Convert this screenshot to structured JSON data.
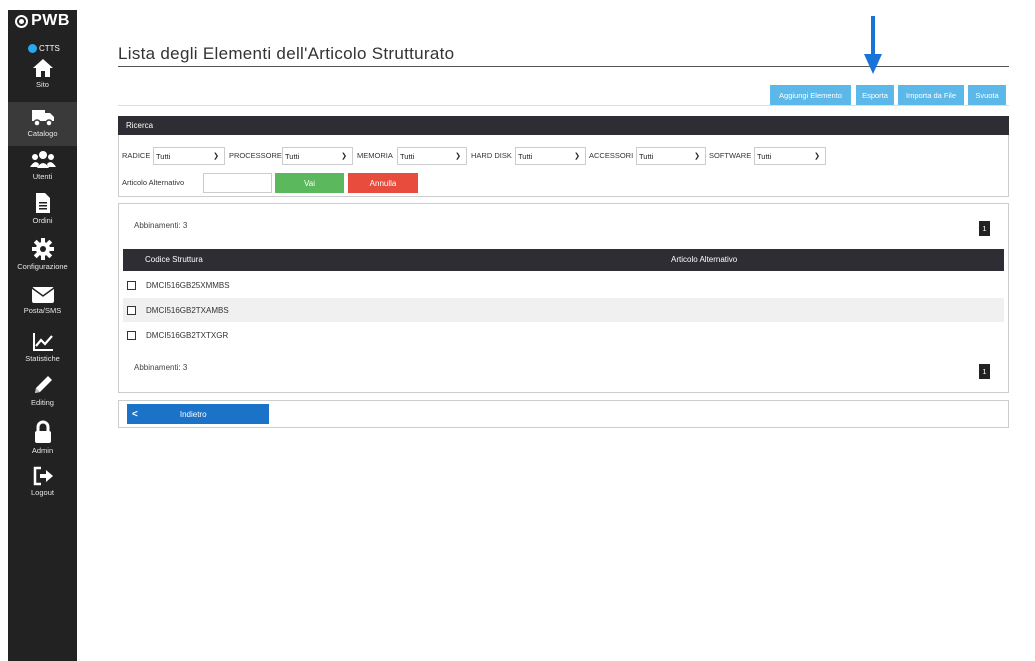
{
  "brand": {
    "name": "PWB",
    "status": "CTTS"
  },
  "sidebar": {
    "items": [
      {
        "label": "Sito",
        "icon": "home-icon"
      },
      {
        "label": "Catalogo",
        "icon": "truck-icon",
        "active": true
      },
      {
        "label": "Utenti",
        "icon": "users-icon"
      },
      {
        "label": "Ordini",
        "icon": "document-icon"
      },
      {
        "label": "Configurazione",
        "icon": "gear-icon"
      },
      {
        "label": "Posta/SMS",
        "icon": "envelope-icon"
      },
      {
        "label": "Statistiche",
        "icon": "chart-icon"
      },
      {
        "label": "Editing",
        "icon": "pencil-icon"
      },
      {
        "label": "Admin",
        "icon": "lock-icon"
      },
      {
        "label": "Logout",
        "icon": "logout-icon"
      }
    ]
  },
  "page": {
    "title": "Lista degli Elementi dell'Articolo Strutturato"
  },
  "toolbar": {
    "add_label": "Aggiungi Elemento",
    "export_label": "Esporta",
    "import_label": "Importa da File",
    "clear_label": "Svuota"
  },
  "search": {
    "title": "Ricerca",
    "filters": [
      {
        "label": "RADICE",
        "value": "Tutti"
      },
      {
        "label": "PROCESSORE",
        "value": "Tutti"
      },
      {
        "label": "MEMORIA",
        "value": "Tutti"
      },
      {
        "label": "HARD DISK",
        "value": "Tutti"
      },
      {
        "label": "ACCESSORI",
        "value": "Tutti"
      },
      {
        "label": "SOFTWARE",
        "value": "Tutti"
      }
    ],
    "alt_label": "Articolo Alternativo",
    "alt_value": "",
    "go_label": "Vai",
    "cancel_label": "Annulla"
  },
  "results": {
    "count_text": "Abbinamenti: 3",
    "page": "1",
    "columns": [
      "Codice Struttura",
      "Articolo Alternativo"
    ],
    "rows": [
      {
        "code": "DMCI516GB25XMMBS",
        "alt": ""
      },
      {
        "code": "DMCI516GB2TXAMBS",
        "alt": ""
      },
      {
        "code": "DMCI516GB2TXTXGR",
        "alt": ""
      }
    ]
  },
  "back": {
    "label": "Indietro"
  },
  "colors": {
    "sidebar": "#222222",
    "accent": "#5bb8e8",
    "success": "#5cb85c",
    "danger": "#e74c3c",
    "primary": "#1a73c7",
    "arrow": "#1a73d9"
  }
}
